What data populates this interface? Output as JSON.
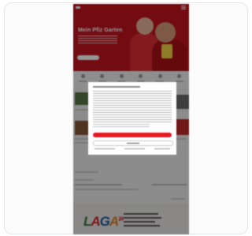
{
  "hero": {
    "title": "Mein Pfiz Garten"
  },
  "footer_logo": {
    "wordmark": "LAGA",
    "suffix": "24"
  },
  "colors": {
    "brand_red": "#c4161f",
    "accept_button": "#e51b23",
    "logo_green": "#2f7d3a",
    "logo_blue": "#1f5fa8",
    "logo_orange": "#e3801f"
  },
  "icons": [
    "menu-icon",
    "category-icon"
  ]
}
